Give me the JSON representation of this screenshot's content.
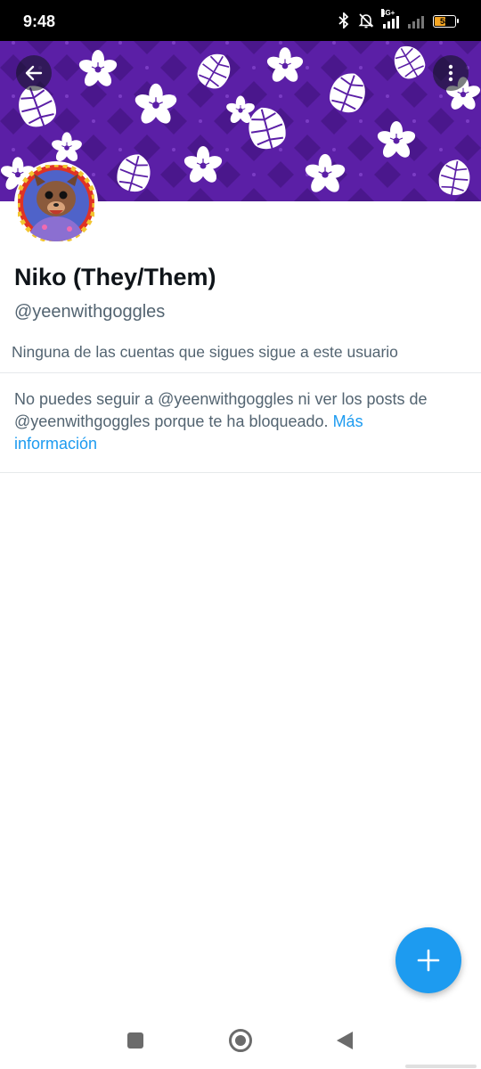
{
  "status_bar": {
    "time": "9:48",
    "network": "4G+",
    "battery_level": "58",
    "battery_percent": 58,
    "icons": [
      "bluetooth-icon",
      "bell-muted-icon",
      "signal-icon",
      "signal-weak-icon",
      "battery-icon"
    ]
  },
  "banner": {
    "background_color": "#5b1fa6",
    "pattern": "white hibiscus and monstera leaves"
  },
  "top_actions": {
    "back_icon": "arrow-left-icon",
    "more_icon": "more-vertical-icon"
  },
  "profile": {
    "display_name": "Niko (They/Them)",
    "handle": "@yeenwithgoggles",
    "followers_you_know": "Ninguna de las cuentas que sigues sigue a este usuario"
  },
  "blocked_notice": {
    "text": "No puedes seguir a @yeenwithgoggles ni ver los posts de @yeenwithgoggles porque te ha bloqueado.",
    "link_text": "Más información"
  },
  "fab": {
    "icon": "plus-icon",
    "color": "#1d9bf0"
  },
  "nav_bar": {
    "icons": [
      "recents-icon",
      "home-icon",
      "back-icon"
    ]
  },
  "colors": {
    "accent": "#1d9bf0",
    "primary_text": "#0f1419",
    "secondary_text": "#536471"
  }
}
